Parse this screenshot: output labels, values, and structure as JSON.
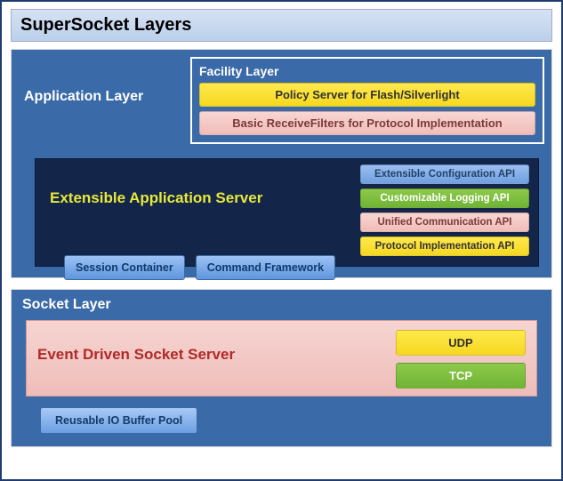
{
  "title": "SuperSocket Layers",
  "app_layer": {
    "label": "Application Layer",
    "facility": {
      "title": "Facility Layer",
      "policy": "Policy Server for Flash/Silverlight",
      "filters": "Basic ReceiveFilters for Protocol Implementation"
    },
    "ext": {
      "title": "Extensible Application Server",
      "apis": {
        "config": "Extensible Configuration API",
        "logging": "Customizable Logging API",
        "comm": "Unified Communication API",
        "protocol": "Protocol Implementation API"
      },
      "session": "Session Container",
      "command": "Command Framework"
    }
  },
  "socket_layer": {
    "title": "Socket Layer",
    "evt_title": "Event Driven Socket Server",
    "udp": "UDP",
    "tcp": "TCP",
    "reusable": "Reusable IO Buffer Pool"
  }
}
